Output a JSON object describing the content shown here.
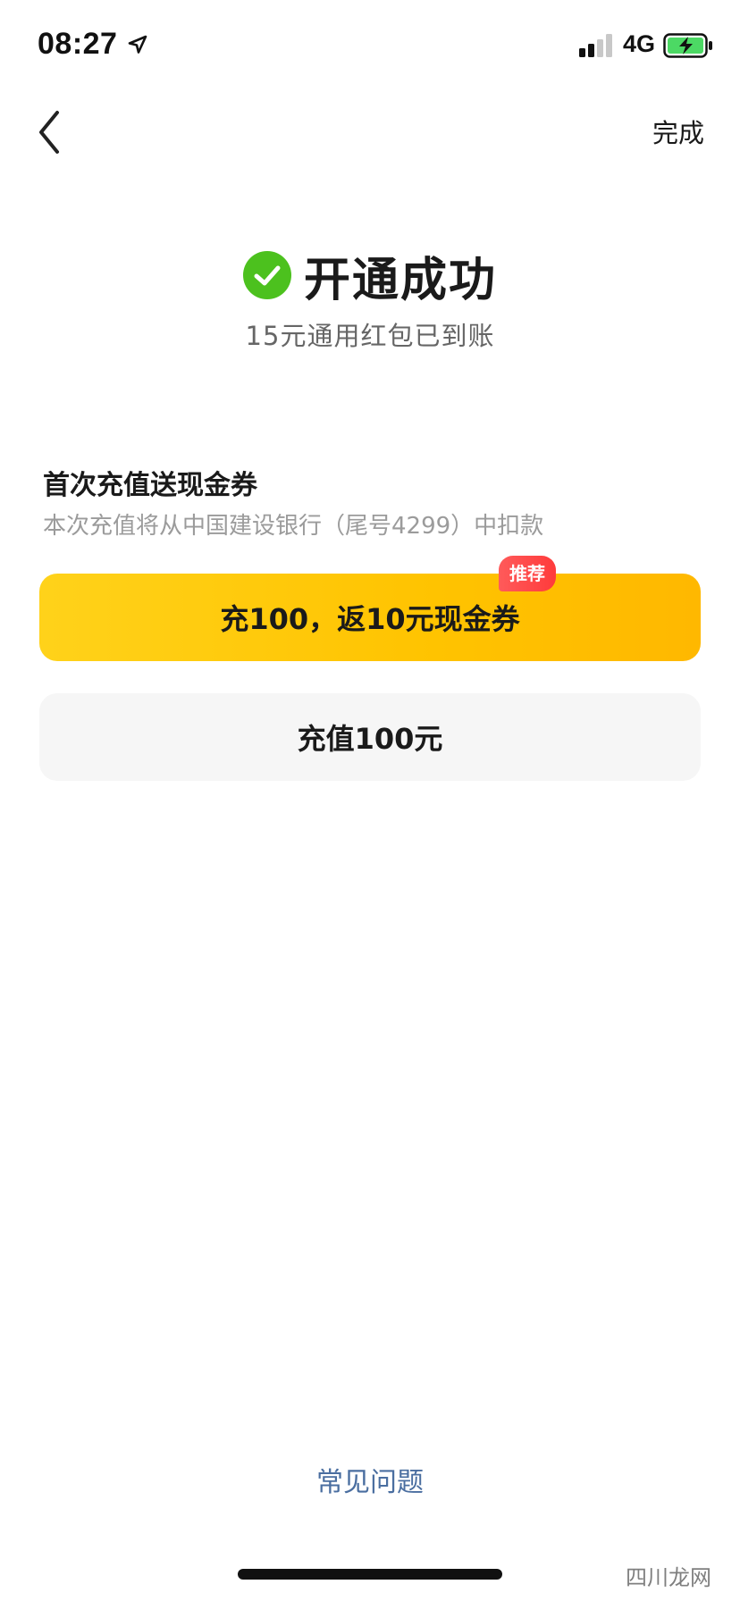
{
  "status_bar": {
    "time": "08:27",
    "network": "4G",
    "location_icon": "location-arrow-icon",
    "signal_icon": "signal-bars-icon",
    "battery_icon": "battery-charging-icon",
    "battery_color": "#4cd964"
  },
  "nav": {
    "back_icon": "chevron-left-icon",
    "done_label": "完成"
  },
  "success": {
    "icon": "check-circle-icon",
    "icon_color": "#4cc11e",
    "title": "开通成功",
    "subtitle": "15元通用红包已到账"
  },
  "recharge": {
    "title": "首次充值送现金券",
    "description": "本次充值将从中国建设银行（尾号4299）中扣款",
    "options": [
      {
        "label": "充100，返10元现金券",
        "badge": "推荐",
        "accent": "#ffc300"
      },
      {
        "label": "充值100元"
      }
    ]
  },
  "faq": {
    "label": "常见问题",
    "color": "#4a6ea0"
  },
  "watermark": "四川龙网"
}
